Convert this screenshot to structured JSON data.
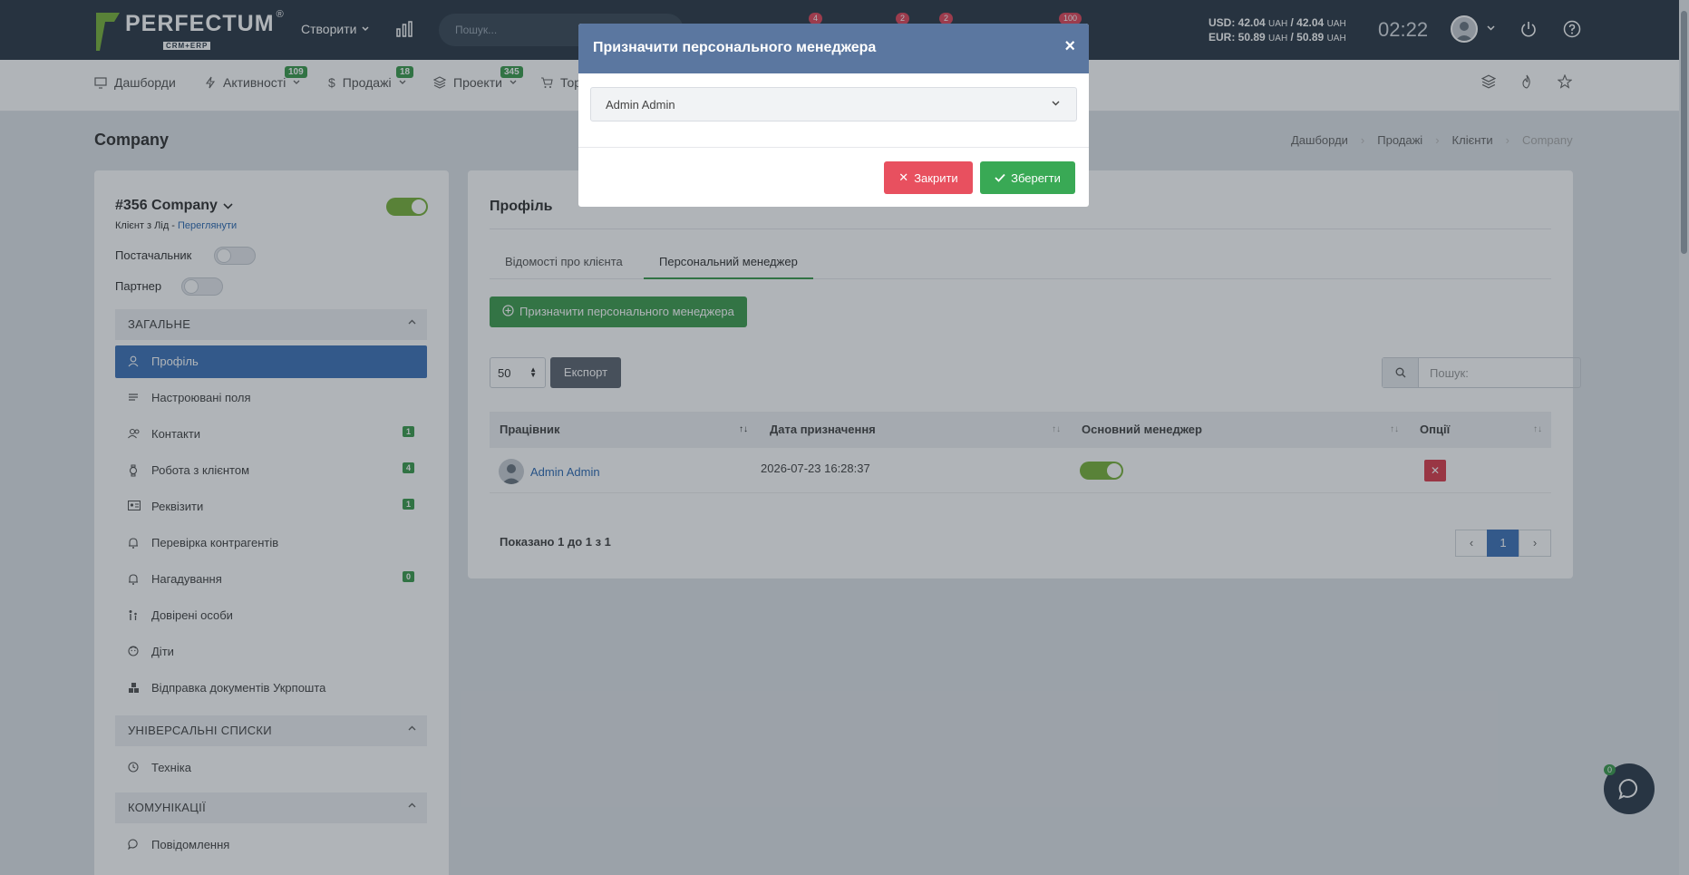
{
  "topbar": {
    "logo_text": "PERFECTUM",
    "logo_sub": "CRM+ERP",
    "logo_reg": "®",
    "create_label": "Створити",
    "search_placeholder": "Пошук...",
    "badges": [
      "4",
      "2",
      "2",
      "100"
    ],
    "rates": {
      "usd": "USD: 42.04",
      "usd_unit1": "UAH",
      "usd_sep": "/ 42.04",
      "usd_unit2": "UAH",
      "eur": "EUR: 50.89",
      "eur_unit1": "UAH",
      "eur_sep": "/ 50.89",
      "eur_unit2": "UAH"
    },
    "clock": "02:22"
  },
  "menu": {
    "items": [
      {
        "label": "Дашборди",
        "icon": "monitor-icon",
        "badge": ""
      },
      {
        "label": "Активності",
        "icon": "bolt-icon",
        "badge": "109"
      },
      {
        "label": "Продажі",
        "icon": "dollar-icon",
        "badge": "18"
      },
      {
        "label": "Проекти",
        "icon": "layers-icon",
        "badge": "345"
      },
      {
        "label": "Тор",
        "icon": "cart-icon",
        "badge": ""
      }
    ]
  },
  "page": {
    "title": "Company",
    "breadcrumb": [
      "Дашборди",
      "Продажі",
      "Клієнти",
      "Company"
    ]
  },
  "sidebar": {
    "company_name": "#356 Company",
    "subtitle_prefix": "Клієнт з Лід - ",
    "subtitle_link": "Переглянути",
    "supplier_label": "Постачальник",
    "partner_label": "Партнер",
    "sections": [
      {
        "title": "ЗАГАЛЬНЕ"
      },
      {
        "title": "УНІВЕРСАЛЬНІ СПИСКИ"
      },
      {
        "title": "КОМУНІКАЦІЇ"
      }
    ],
    "items": [
      {
        "label": "Профіль",
        "icon": "user-icon",
        "count": ""
      },
      {
        "label": "Настроювані поля",
        "icon": "lines-icon",
        "count": ""
      },
      {
        "label": "Контакти",
        "icon": "users-icon",
        "count": "1"
      },
      {
        "label": "Робота з клієнтом",
        "icon": "watch-icon",
        "count": "4"
      },
      {
        "label": "Реквізити",
        "icon": "id-card-icon",
        "count": "1"
      },
      {
        "label": "Перевірка контрагентів",
        "icon": "bell-icon",
        "count": ""
      },
      {
        "label": "Нагадування",
        "icon": "bell-icon",
        "count": "0"
      },
      {
        "label": "Довірені особи",
        "icon": "people-icon",
        "count": ""
      },
      {
        "label": "Діти",
        "icon": "baby-icon",
        "count": ""
      },
      {
        "label": "Відправка документів Укрпошта",
        "icon": "boxes-icon",
        "count": ""
      },
      {
        "label": "Техніка",
        "icon": "clock-icon",
        "count": ""
      },
      {
        "label": "Повідомлення",
        "icon": "chat-icon",
        "count": ""
      }
    ]
  },
  "main": {
    "title": "Профіль",
    "tabs": [
      "Відомості про клієнта",
      "Персональний менеджер"
    ],
    "assign_button": "Призначити персонального менеджера",
    "page_length": "50",
    "export_button": "Експорт",
    "search_placeholder": "Пошук:",
    "table": {
      "columns": [
        "Працівник",
        "Дата призначення",
        "Основний менеджер",
        "Опції"
      ],
      "rows": [
        {
          "employee": "Admin Admin",
          "date": "2026-07-23 16:28:37",
          "main_manager": true
        }
      ]
    },
    "info": "Показано 1 до 1 з 1",
    "pages": [
      "1"
    ]
  },
  "modal": {
    "title": "Призначити персонального менеджера",
    "close_symbol": "×",
    "selected": "Admin Admin",
    "close_button": "Закрити",
    "save_button": "Зберегти"
  },
  "chat": {
    "badge": "0"
  },
  "colors": {
    "topbar": "#2d3a47",
    "accent_blue": "#3f74b8",
    "green": "#3f9d4f",
    "red": "#dc3e4e",
    "modal_header": "#5b77a0"
  }
}
